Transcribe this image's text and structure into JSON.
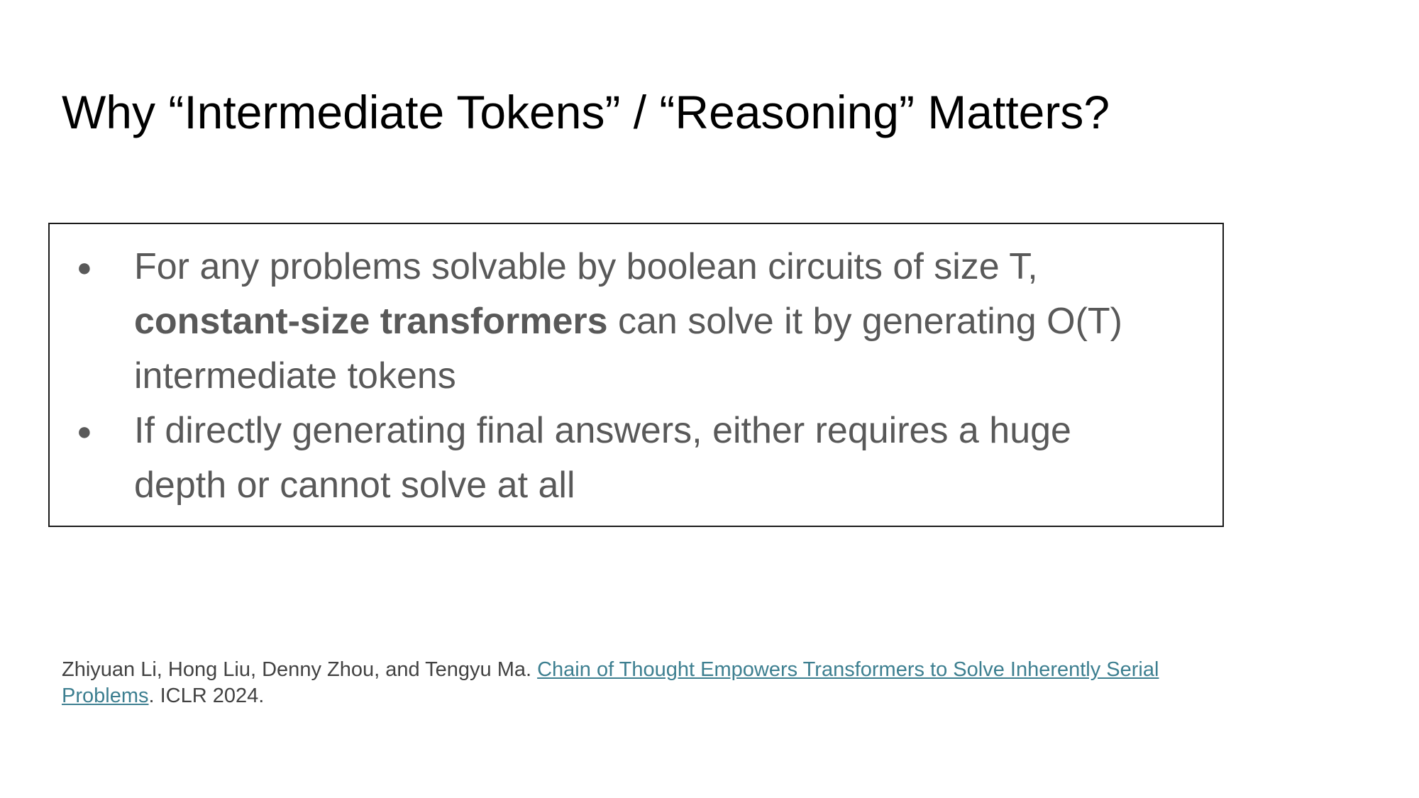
{
  "slide": {
    "title": "Why “Intermediate Tokens” / “Reasoning” Matters?",
    "bullets": [
      {
        "line1": "For any problems solvable by boolean circuits of size T,",
        "line2_bold": "constant-size transformers",
        "line2_rest": " can solve it by generating O(T)",
        "line3": "intermediate tokens"
      },
      {
        "line1": "If directly generating final answers, either requires a huge",
        "line2": "depth or cannot solve at all"
      }
    ],
    "bullet_symbol": "●",
    "citation": {
      "authors": "Zhiyuan Li, Hong Liu, Denny Zhou, and Tengyu Ma. ",
      "link_part1": "Chain of Thought Empowers Transformers to Solve Inherently Serial",
      "link_part2": "Problems",
      "venue": ". ICLR 2024."
    }
  },
  "colors": {
    "title": "#000000",
    "body_text": "#595959",
    "citation_text": "#424242",
    "link": "#3d7f90",
    "box_border": "#1a1a1a"
  }
}
